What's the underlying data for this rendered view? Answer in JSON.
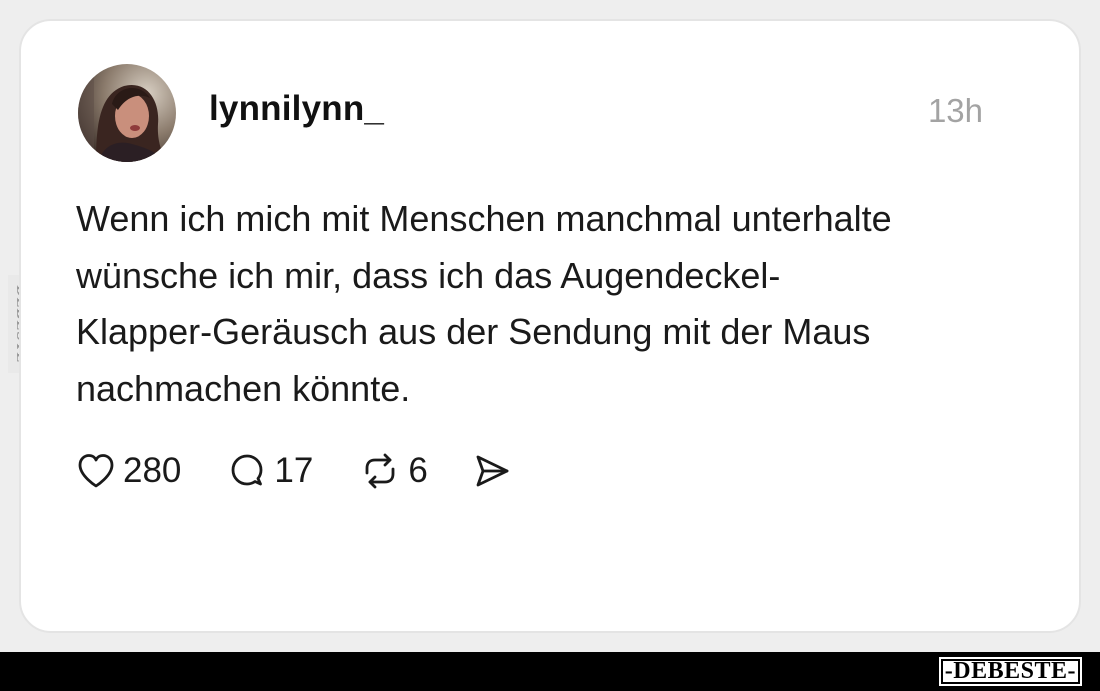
{
  "post": {
    "username": "lynnilynn_",
    "time": "13h",
    "text": "Wenn ich mich mit Menschen manchmal unterhalte\nwünsche ich mir, dass ich das Augendeckel-\nKlapper-Geräusch aus der Sendung mit der Maus\nnachmachen könnte.",
    "likes": "280",
    "comments": "17",
    "reposts": "6"
  },
  "icons": {
    "like": "heart-icon",
    "comment": "speech-bubble-icon",
    "repost": "repost-arrows-icon",
    "share": "send-icon"
  },
  "watermark": {
    "side": "DEBESTE",
    "bottom": "-DEBESTE-"
  },
  "colors": {
    "card_background": "#ffffff",
    "page_background": "#eeeeee",
    "text": "#1a1a1a",
    "muted": "#a3a3a3",
    "bottom_bar": "#000000"
  }
}
